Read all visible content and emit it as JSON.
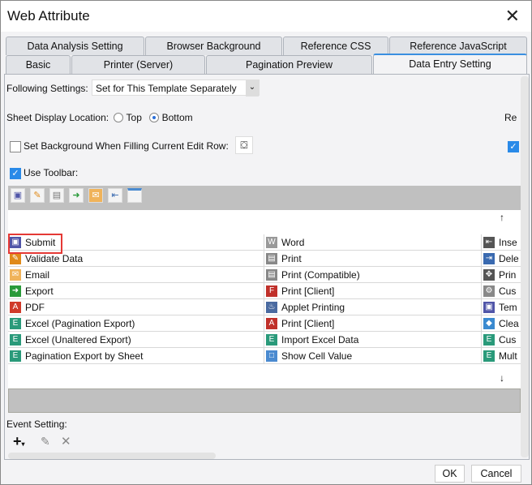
{
  "window": {
    "title": "Web Attribute"
  },
  "tabs": {
    "row1": [
      "Data Analysis Setting",
      "Browser Background",
      "Reference CSS",
      "Reference JavaScript"
    ],
    "row2": [
      "Basic",
      "Printer (Server)",
      "Pagination Preview",
      "Data Entry Setting"
    ],
    "active": "Data Entry Setting"
  },
  "settings": {
    "following_label": "Following Settings:",
    "following_value": "Set for This Template Separately",
    "sheet_location_label": "Sheet Display Location:",
    "top": "Top",
    "bottom": "Bottom",
    "selected_location": "Bottom",
    "right_cut_label": "Re",
    "set_background_label": "Set Background When Filling Current Edit Row:",
    "set_background_checked": false,
    "use_toolbar_label": "Use Toolbar:",
    "use_toolbar_checked": true
  },
  "list": {
    "col1": [
      "Submit",
      "Validate Data",
      "Email",
      "Export",
      "PDF",
      "Excel (Pagination Export)",
      "Excel (Unaltered Export)",
      "Pagination Export by Sheet"
    ],
    "col2": [
      "Word",
      "Print",
      "Print (Compatible)",
      "Print [Client]",
      "Applet Printing",
      "Print [Client]",
      "Import Excel Data",
      "Show Cell Value"
    ],
    "col3": [
      "Inse",
      "Dele",
      "Prin",
      "Cus",
      "Tem",
      "Clea",
      "Cus",
      "Mult"
    ],
    "up_arrow": "↑",
    "down_arrow": "↓"
  },
  "event": {
    "label": "Event Setting:"
  },
  "footer": {
    "ok": "OK",
    "cancel": "Cancel"
  },
  "colors": {
    "accent": "#2a8ae8",
    "highlight": "#e53935"
  }
}
